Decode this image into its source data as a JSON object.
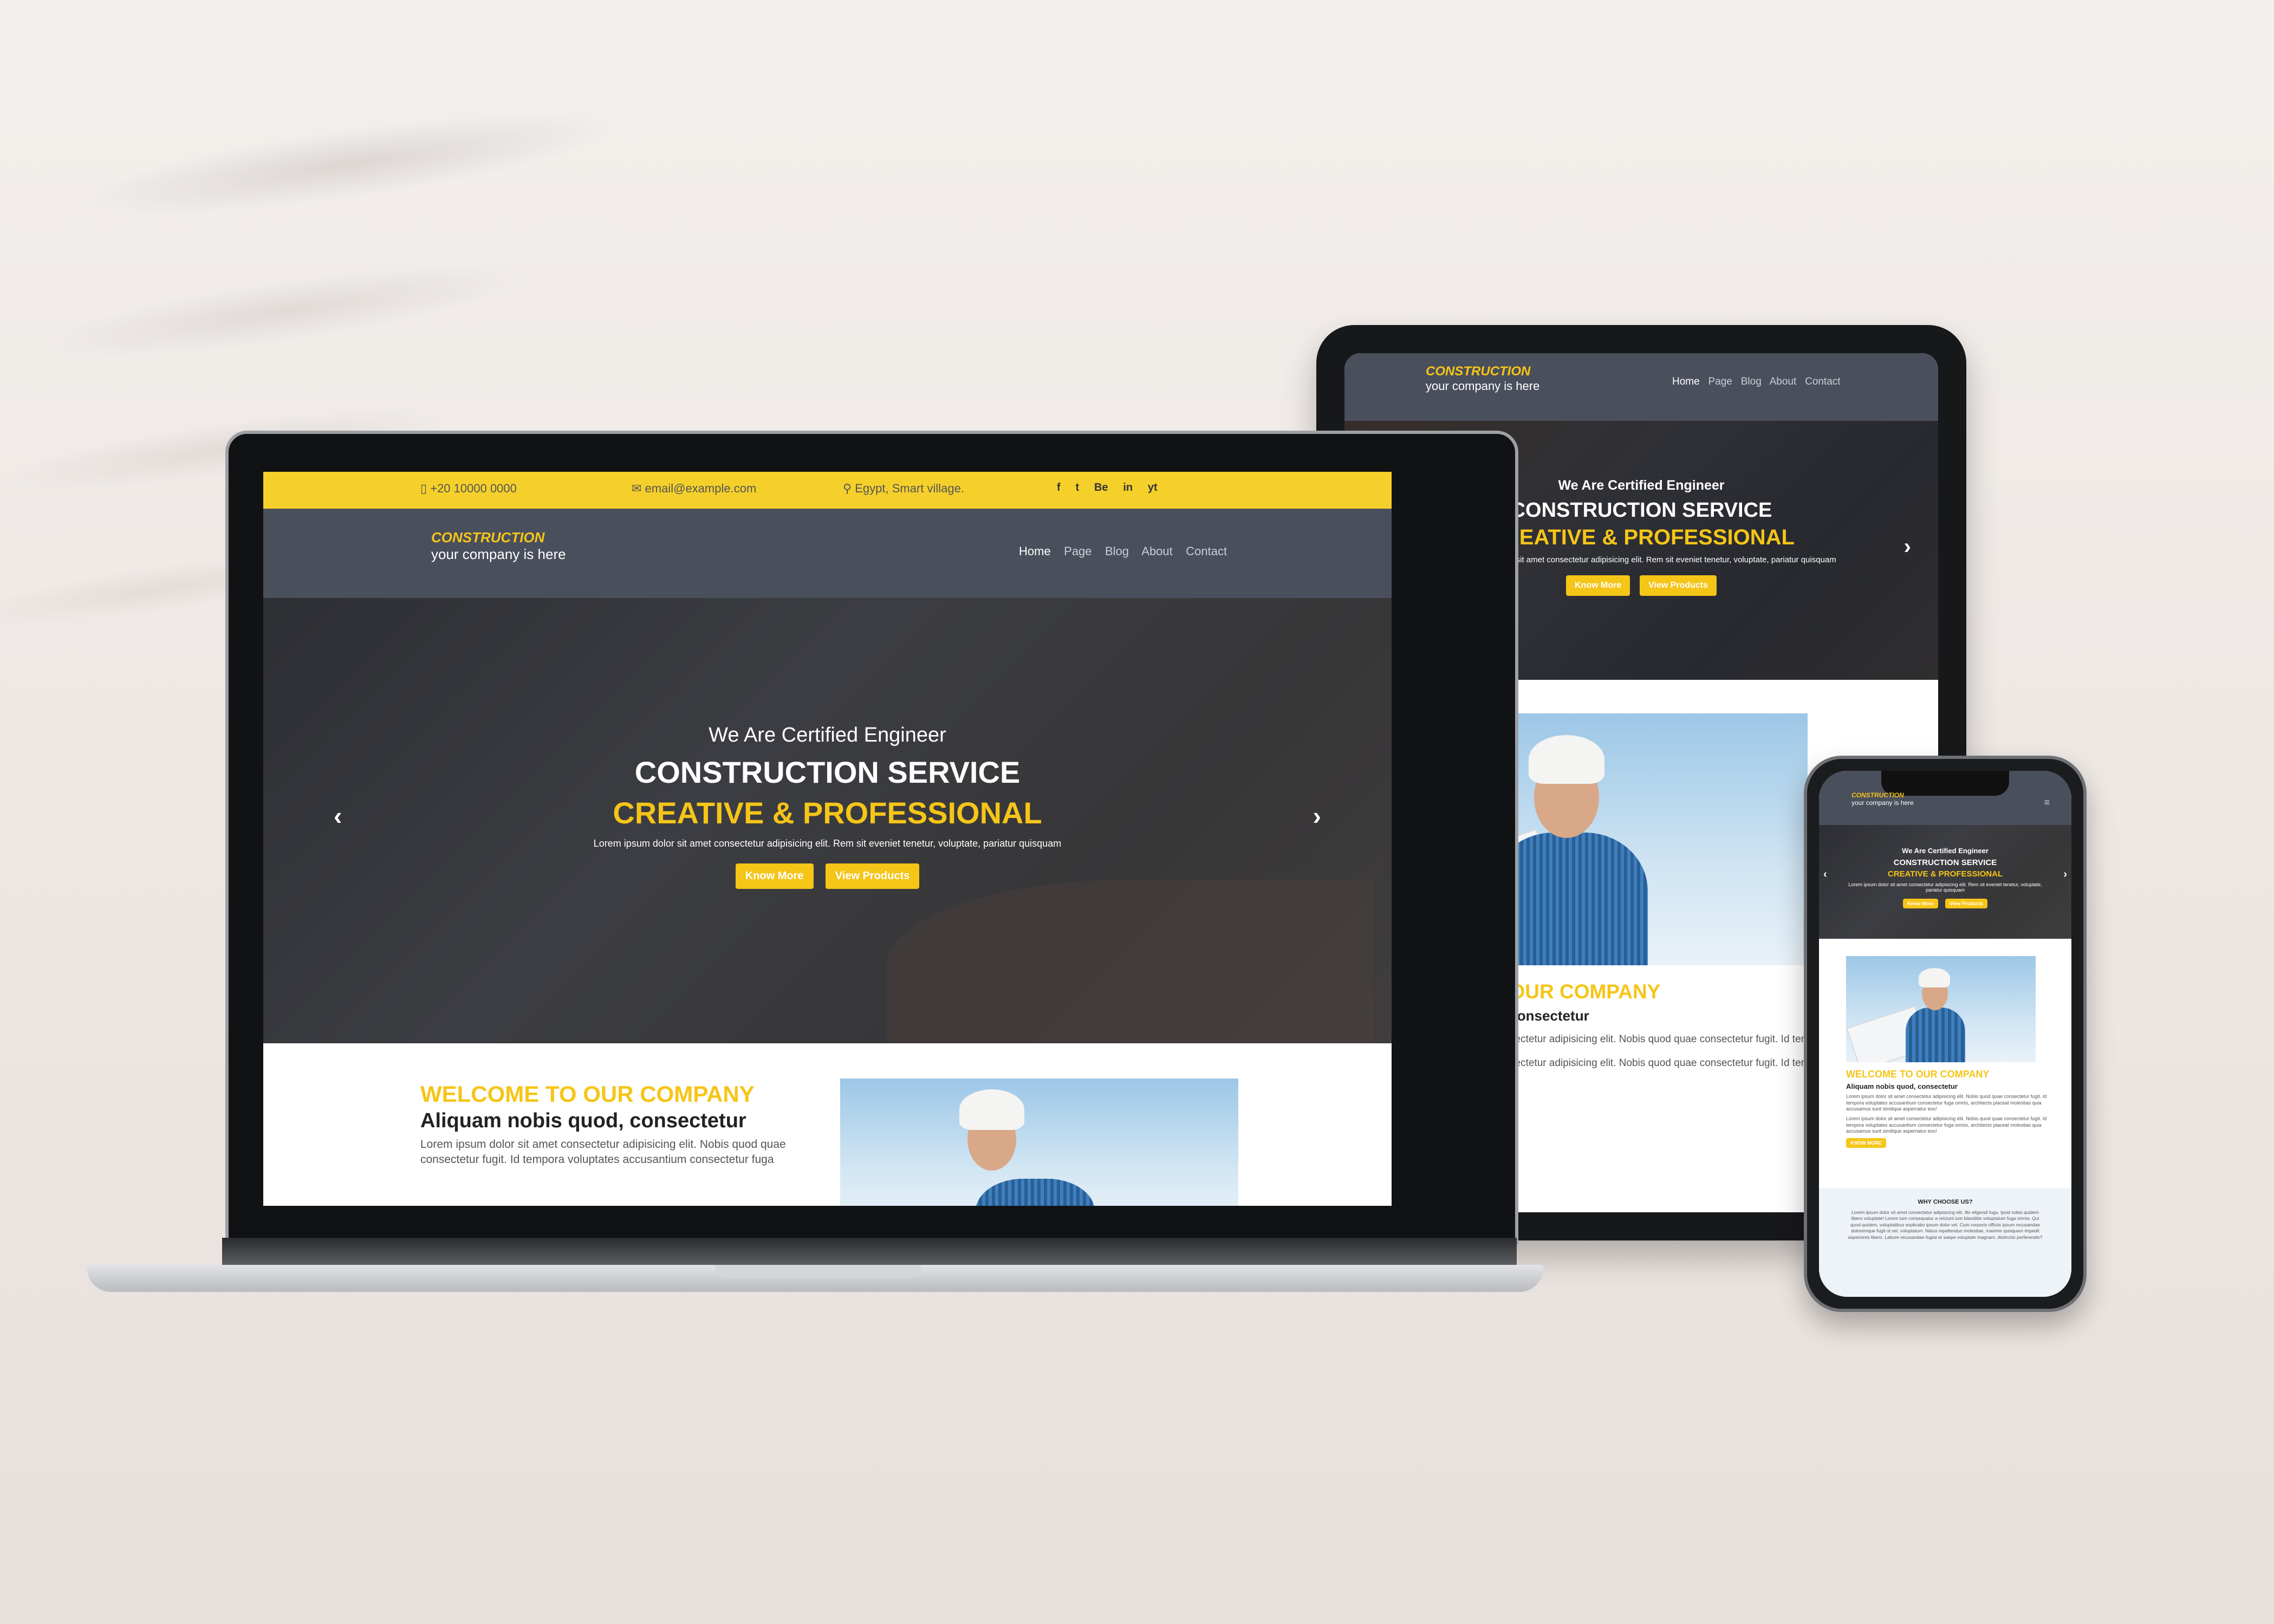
{
  "colors": {
    "accent": "#f5c518",
    "navbar": "#4a4f5c",
    "topbar": "#f5d02a"
  },
  "topbar": {
    "phone": "+20 10000 0000",
    "email": "email@example.com",
    "location": "Egypt, Smart village.",
    "social": [
      "f",
      "t",
      "Be",
      "in",
      "yt"
    ]
  },
  "brand": {
    "title": "CONSTRUCTION",
    "subtitle": "your company is here"
  },
  "nav": [
    "Home",
    "Page",
    "Blog",
    "About",
    "Contact"
  ],
  "hero": {
    "kicker": "We Are Certified Engineer",
    "title": "CONSTRUCTION SERVICE",
    "subtitle": "CREATIVE & PROFESSIONAL",
    "text": "Lorem ipsum dolor sit amet consectetur adipisicing elit. Rem sit eveniet tenetur, voluptate, pariatur quisquam",
    "btn_primary": "Know More",
    "btn_secondary": "View Products",
    "prev": "‹",
    "next": "›"
  },
  "welcome": {
    "heading": "WELCOME TO OUR COMPANY",
    "subheading": "Aliquam nobis quod, consectetur",
    "para1": "Lorem ipsum dolor sit amet consectetur adipisicing elit. Nobis quod quae consectetur fugit. Id tempora voluptates accusantium consectetur fuga omnis, architecto placeat molestias quia accusamus sunt similique aspernatur eos!",
    "para2": "Lorem ipsum dolor sit amet consectetur adipisicing elit. Nobis quod quae consectetur fugit. Id tempora voluptates accusantium consectetur fuga omnis, architecto placeat molestias quia accusamus sunt similique aspernatur eos!",
    "laptop_line1": "Lorem ipsum dolor sit amet consectetur adipisicing elit. Nobis quod quae",
    "laptop_line2": "consectetur fugit. Id tempora voluptates accusantium consectetur fuga",
    "btn": "KNOW MORE"
  },
  "why": {
    "heading": "WHY CHOOSE US?",
    "text": "Lorem ipsum dolor sit amet consectetur adipisicing elit. Illo eligendi fuga. Ipsid nobis quidem libero voluptate! Lorem iure consequatur a reiciunt iure blanditiis voluptatum fuga omnis. Qui quod quidem, voluptatibus explicabo ipsum dolor vel. Cum corporis officiis ipsum recusandae doloremque fugit ut vel, voluptatum. Natus repellendus molestiae, maxime quisquam impedit asperiores libero. Labore recusandae fugiat et saepe voluptate magnam, distinctio perferendis?"
  }
}
